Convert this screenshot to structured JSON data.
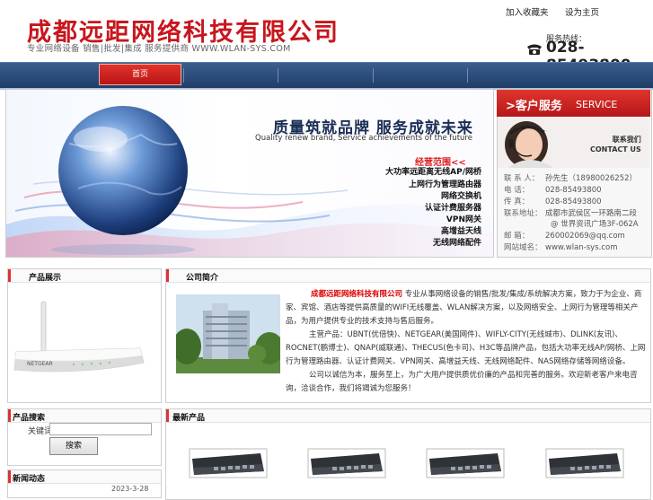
{
  "header": {
    "company_name": "成都远距网络科技有限公司",
    "tagline": "专业网络设备 销售|批发|集成 服务提供商 WWW.WLAN-SYS.COM",
    "links": [
      "加入收藏夹",
      "设为主页"
    ],
    "hotline_label": "服务热线：",
    "hotline_number": "028-85493800"
  },
  "nav": {
    "items": [
      "首页",
      "",
      "",
      "",
      ""
    ],
    "active_index": 0
  },
  "banner": {
    "title": "质量筑就品牌 服务成就未来",
    "subtitle": "Quality renew brand, Service achievements of the future",
    "scope_title": "经营范围<<",
    "scope_items": [
      "大功率远距离无线AP/网桥",
      "上网行为管理路由器",
      "网络交换机",
      "认证计费服务器",
      "VPN网关",
      "高增益天线",
      "无线网络配件"
    ]
  },
  "service": {
    "title_cn": ">客户服务",
    "title_en": "SERVICE",
    "contact_cn": "联系我们",
    "contact_en": "CONTACT US",
    "lines": [
      {
        "label": "联 系 人：",
        "value": "孙先生（18980026252）"
      },
      {
        "label": "电    话：",
        "value": "028-85493800"
      },
      {
        "label": "传    真：",
        "value": "028-85493800"
      },
      {
        "label": "联系地址：",
        "value": "成都市武侯区一环路南二段"
      },
      {
        "label": "",
        "value": "@ 世界资讯广场3F-062A"
      },
      {
        "label": "邮    箱：",
        "value": "260002069@qq.com"
      },
      {
        "label": "网站域名：",
        "value": "www.wlan-sys.com"
      }
    ]
  },
  "left_boxes": {
    "product_title": "产品展示",
    "search_title": "产品搜索",
    "search_label": "关键词",
    "search_placeholder": "",
    "search_button": "搜索",
    "news_title": "新闻动态",
    "news_date": "2023-3-28"
  },
  "about": {
    "title": "公司简介",
    "highlight": "成都远距网络科技有限公司",
    "paragraph1": "专业从事网络设备的销售/批发/集成/系统解决方案，致力于为企业、商家、宾馆、酒店等提供高质量的WIFI无线覆盖、WLAN解决方案，以及网络安全、上网行为管理等相关产品，为用户提供专业的技术支持与售后服务。",
    "paragraph2": "主营产品：UBNT(优倍快)、NETGEAR(美国网件)、WIFLY-CITY(无线城市)、DLINK(友讯)、ROCNET(鹏博士)、QNAP(威联通)、THECUS(色卡司)、H3C等品牌产品，包括大功率无线AP/网桥、上网行为管理路由器、认证计费网关、VPN网关、高增益天线、无线网络配件、NAS网络存储等网络设备。",
    "paragraph3": "公司以诚信为本，服务至上，为广大用户提供质优价廉的产品和完善的服务。欢迎新老客户来电咨询，洽谈合作，我们将竭诚为您服务！"
  },
  "products": {
    "title": "最新产品",
    "count_shown": 4
  },
  "colors": {
    "brand_red": "#c8161d",
    "nav_blue": "#2b4c7a",
    "accent_red": "#d33333"
  }
}
